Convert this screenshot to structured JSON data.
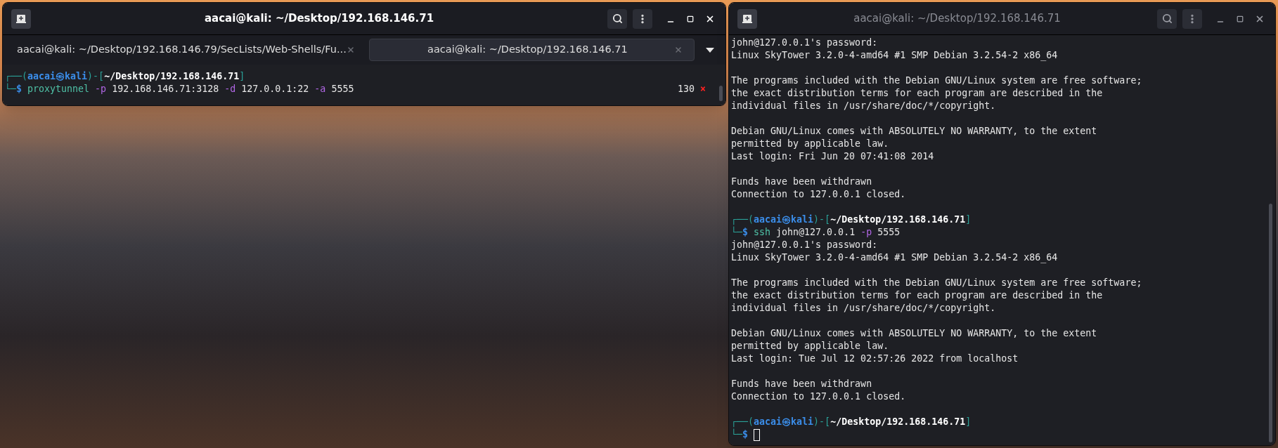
{
  "windows": [
    {
      "title": "aacai@kali: ~/Desktop/192.168.146.71",
      "active": true,
      "tabs": [
        {
          "label": "aacai@kali: ~/Desktop/192.168.146.79/SecLists/Web-Shells/Fu...",
          "selected": false
        },
        {
          "label": "aacai@kali: ~/Desktop/192.168.146.71",
          "selected": true
        }
      ],
      "lines": [
        {
          "kind": "segments",
          "segments": [
            {
              "kind": "frame",
              "text": "┌──("
            },
            {
              "kind": "user",
              "text": "aacai㉿kali"
            },
            {
              "kind": "frame",
              "text": ")-["
            },
            {
              "kind": "path",
              "text": "~/Desktop/192.168.146.71"
            },
            {
              "kind": "frame",
              "text": "]"
            }
          ]
        },
        {
          "kind": "segments",
          "exit_code": "130",
          "exit_mark": "×",
          "segments": [
            {
              "kind": "frame",
              "text": "└─"
            },
            {
              "kind": "prompt",
              "text": "$ "
            },
            {
              "kind": "command",
              "text": "proxytunnel "
            },
            {
              "kind": "flag",
              "text": "-p "
            },
            {
              "kind": "plain",
              "text": "192.168.146.71:3128 "
            },
            {
              "kind": "flag",
              "text": "-d "
            },
            {
              "kind": "plain",
              "text": "127.0.0.1:22 "
            },
            {
              "kind": "flag",
              "text": "-a "
            },
            {
              "kind": "plain",
              "text": "5555"
            }
          ]
        }
      ]
    },
    {
      "title": "aacai@kali: ~/Desktop/192.168.146.71",
      "active": false,
      "lines": [
        {
          "kind": "output",
          "text": "john@127.0.0.1's password:"
        },
        {
          "kind": "output",
          "text": "Linux SkyTower 3.2.0-4-amd64 #1 SMP Debian 3.2.54-2 x86_64"
        },
        {
          "kind": "blank"
        },
        {
          "kind": "output",
          "text": "The programs included with the Debian GNU/Linux system are free software;"
        },
        {
          "kind": "output",
          "text": "the exact distribution terms for each program are described in the"
        },
        {
          "kind": "output",
          "text": "individual files in /usr/share/doc/*/copyright."
        },
        {
          "kind": "blank"
        },
        {
          "kind": "output",
          "text": "Debian GNU/Linux comes with ABSOLUTELY NO WARRANTY, to the extent"
        },
        {
          "kind": "output",
          "text": "permitted by applicable law."
        },
        {
          "kind": "output",
          "text": "Last login: Fri Jun 20 07:41:08 2014"
        },
        {
          "kind": "blank"
        },
        {
          "kind": "output",
          "text": "Funds have been withdrawn"
        },
        {
          "kind": "output",
          "text": "Connection to 127.0.0.1 closed."
        },
        {
          "kind": "blank"
        },
        {
          "kind": "segments",
          "segments": [
            {
              "kind": "frame",
              "text": "┌──("
            },
            {
              "kind": "user",
              "text": "aacai㉿kali"
            },
            {
              "kind": "frame",
              "text": ")-["
            },
            {
              "kind": "path",
              "text": "~/Desktop/192.168.146.71"
            },
            {
              "kind": "frame",
              "text": "]"
            }
          ]
        },
        {
          "kind": "segments",
          "segments": [
            {
              "kind": "frame",
              "text": "└─"
            },
            {
              "kind": "prompt",
              "text": "$ "
            },
            {
              "kind": "command",
              "text": "ssh "
            },
            {
              "kind": "plain",
              "text": "john@127.0.0.1 "
            },
            {
              "kind": "flag",
              "text": "-p "
            },
            {
              "kind": "plain",
              "text": "5555"
            }
          ]
        },
        {
          "kind": "output",
          "text": "john@127.0.0.1's password:"
        },
        {
          "kind": "output",
          "text": "Linux SkyTower 3.2.0-4-amd64 #1 SMP Debian 3.2.54-2 x86_64"
        },
        {
          "kind": "blank"
        },
        {
          "kind": "output",
          "text": "The programs included with the Debian GNU/Linux system are free software;"
        },
        {
          "kind": "output",
          "text": "the exact distribution terms for each program are described in the"
        },
        {
          "kind": "output",
          "text": "individual files in /usr/share/doc/*/copyright."
        },
        {
          "kind": "blank"
        },
        {
          "kind": "output",
          "text": "Debian GNU/Linux comes with ABSOLUTELY NO WARRANTY, to the extent"
        },
        {
          "kind": "output",
          "text": "permitted by applicable law."
        },
        {
          "kind": "output",
          "text": "Last login: Tue Jul 12 02:57:26 2022 from localhost"
        },
        {
          "kind": "blank"
        },
        {
          "kind": "output",
          "text": "Funds have been withdrawn"
        },
        {
          "kind": "output",
          "text": "Connection to 127.0.0.1 closed."
        },
        {
          "kind": "blank"
        },
        {
          "kind": "segments",
          "segments": [
            {
              "kind": "frame",
              "text": "┌──("
            },
            {
              "kind": "user",
              "text": "aacai㉿kali"
            },
            {
              "kind": "frame",
              "text": ")-["
            },
            {
              "kind": "path",
              "text": "~/Desktop/192.168.146.71"
            },
            {
              "kind": "frame",
              "text": "]"
            }
          ]
        },
        {
          "kind": "segments",
          "cursor": true,
          "segments": [
            {
              "kind": "frame",
              "text": "└─"
            },
            {
              "kind": "prompt",
              "text": "$ "
            }
          ]
        }
      ]
    }
  ]
}
